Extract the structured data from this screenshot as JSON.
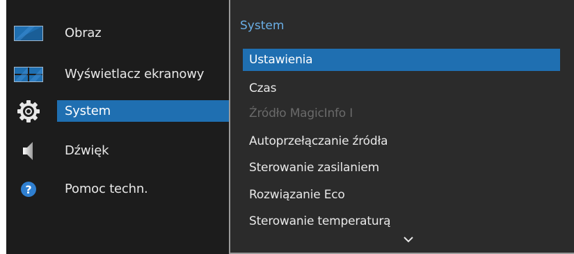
{
  "main_menu": {
    "items": [
      {
        "label": "Obraz",
        "icon": "picture-icon",
        "selected": false
      },
      {
        "label": "Wyświetlacz ekranowy",
        "icon": "onscreen-display-icon",
        "selected": false
      },
      {
        "label": "System",
        "icon": "gear-icon",
        "selected": true
      },
      {
        "label": "Dźwięk",
        "icon": "speaker-icon",
        "selected": false
      },
      {
        "label": "Pomoc techn.",
        "icon": "help-icon",
        "selected": false
      }
    ]
  },
  "submenu": {
    "title": "System",
    "items": [
      {
        "label": "Ustawienia",
        "state": "selected"
      },
      {
        "label": "Czas",
        "state": "normal"
      },
      {
        "label": "Źródło MagicInfo I",
        "state": "disabled"
      },
      {
        "label": "Autoprzełączanie źródła",
        "state": "normal"
      },
      {
        "label": "Sterowanie zasilaniem",
        "state": "normal"
      },
      {
        "label": "Rozwiązanie Eco",
        "state": "normal"
      },
      {
        "label": "Sterowanie temperaturą",
        "state": "normal"
      }
    ],
    "more_indicator": "chevron-down-icon"
  },
  "colors": {
    "accent": "#1f6fb1",
    "title": "#6aaee5",
    "background": "#1c1c1c",
    "panel": "#2b2b2b"
  }
}
